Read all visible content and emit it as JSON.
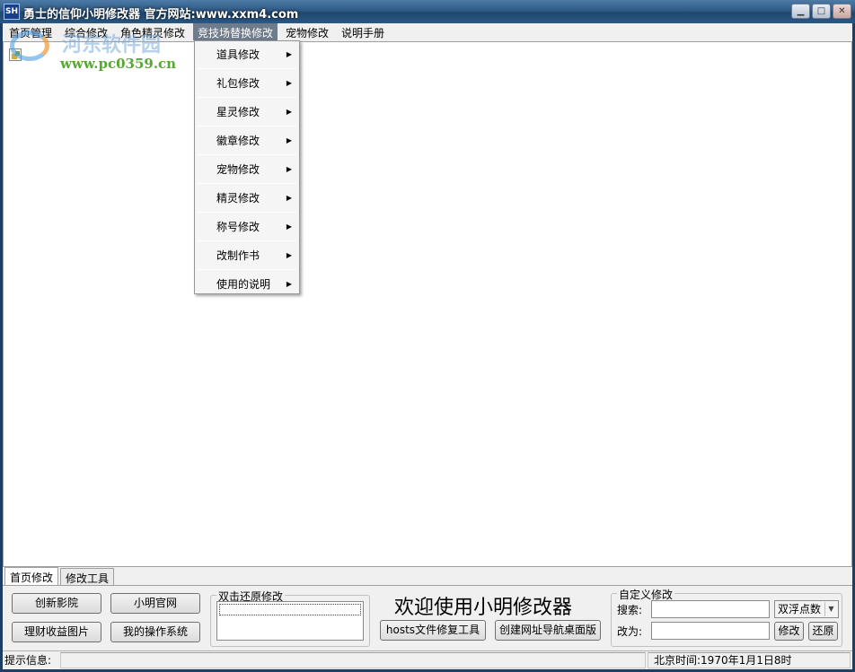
{
  "window": {
    "icon_text": "SH",
    "title": "勇士的信仰小明修改器 官方网站:www.xxm4.com",
    "minimize": "▁",
    "maximize": "□",
    "close": "✕"
  },
  "watermark": {
    "brand": "河东软件园",
    "url": "www.pc0359.cn"
  },
  "menu": {
    "items": [
      {
        "label": "首页管理"
      },
      {
        "label": "综合修改"
      },
      {
        "label": "角色精灵修改"
      },
      {
        "label": "竞技场替换修改"
      },
      {
        "label": "宠物修改"
      },
      {
        "label": "说明手册"
      }
    ],
    "active_index": 3
  },
  "dropdown": {
    "items": [
      {
        "label": "道具修改"
      },
      {
        "label": "礼包修改"
      },
      {
        "label": "星灵修改"
      },
      {
        "label": "徽章修改"
      },
      {
        "label": "宠物修改"
      },
      {
        "label": "精灵修改"
      },
      {
        "label": "称号修改"
      },
      {
        "label": "改制作书"
      },
      {
        "label": "使用的说明"
      }
    ],
    "submenu_arrow": "▶"
  },
  "tabs": [
    {
      "label": "首页修改",
      "active": true
    },
    {
      "label": "修改工具",
      "active": false
    }
  ],
  "panel": {
    "buttons": {
      "chuangxin": "创新影院",
      "guanwang": "小明官网",
      "licai": "理财收益图片",
      "caozuo": "我的操作系统"
    },
    "restore_group_title": "双击还原修改",
    "welcome": "欢迎使用小明修改器",
    "hosts_button": "hosts文件修复工具",
    "nav_button": "创建网址导航桌面版",
    "custom_group_title": "自定义修改",
    "search_label": "搜索:",
    "search_value": "",
    "replace_label": "改为:",
    "replace_value": "",
    "type_select": "双浮点数",
    "modify_button": "修改",
    "restore_button": "还原"
  },
  "status": {
    "hint_label": "提示信息:",
    "hint_text": "",
    "time": "北京时间:1970年1月1日8时"
  }
}
